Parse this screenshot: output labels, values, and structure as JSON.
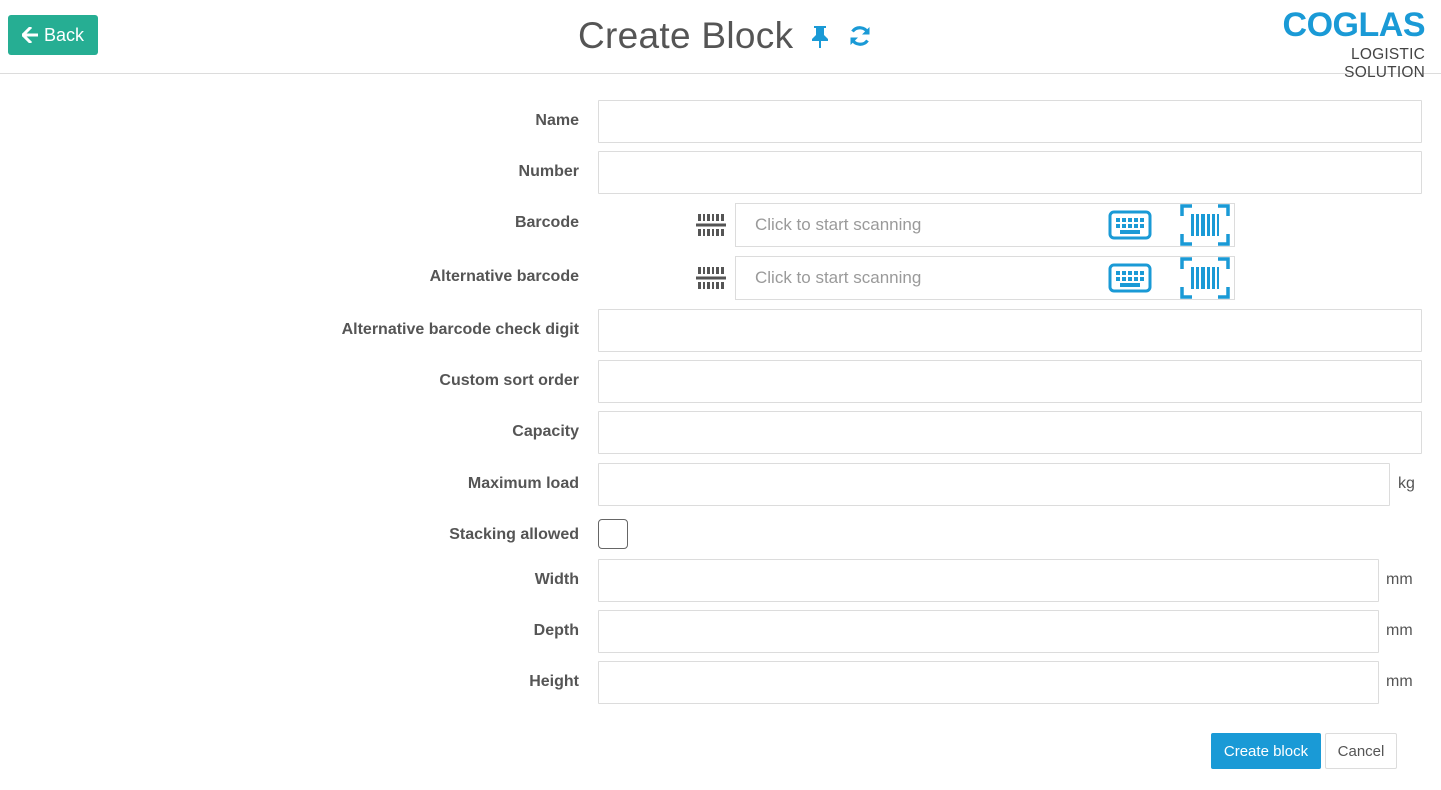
{
  "header": {
    "back_label": "Back",
    "title": "Create Block",
    "pin_icon": "pin-icon",
    "refresh_icon": "refresh-icon",
    "logo_main": "COGLAS",
    "logo_sub": "LOGISTIC SOLUTION"
  },
  "form": {
    "name": {
      "label": "Name",
      "value": ""
    },
    "number": {
      "label": "Number",
      "value": ""
    },
    "barcode": {
      "label": "Barcode",
      "placeholder": "Click to start scanning",
      "value": ""
    },
    "alt_barcode": {
      "label": "Alternative barcode",
      "placeholder": "Click to start scanning",
      "value": ""
    },
    "alt_barcode_check": {
      "label": "Alternative barcode check digit",
      "value": ""
    },
    "custom_sort": {
      "label": "Custom sort order",
      "value": ""
    },
    "capacity": {
      "label": "Capacity",
      "value": ""
    },
    "max_load": {
      "label": "Maximum load",
      "value": "",
      "unit": "kg"
    },
    "stacking": {
      "label": "Stacking allowed",
      "checked": false
    },
    "width": {
      "label": "Width",
      "value": "",
      "unit": "mm"
    },
    "depth": {
      "label": "Depth",
      "value": "",
      "unit": "mm"
    },
    "height": {
      "label": "Height",
      "value": "",
      "unit": "mm"
    }
  },
  "actions": {
    "create_label": "Create block",
    "cancel_label": "Cancel"
  },
  "colors": {
    "accent": "#1a9ad6",
    "back": "#26ae93",
    "border": "#dcdcdc",
    "text": "#555555"
  }
}
